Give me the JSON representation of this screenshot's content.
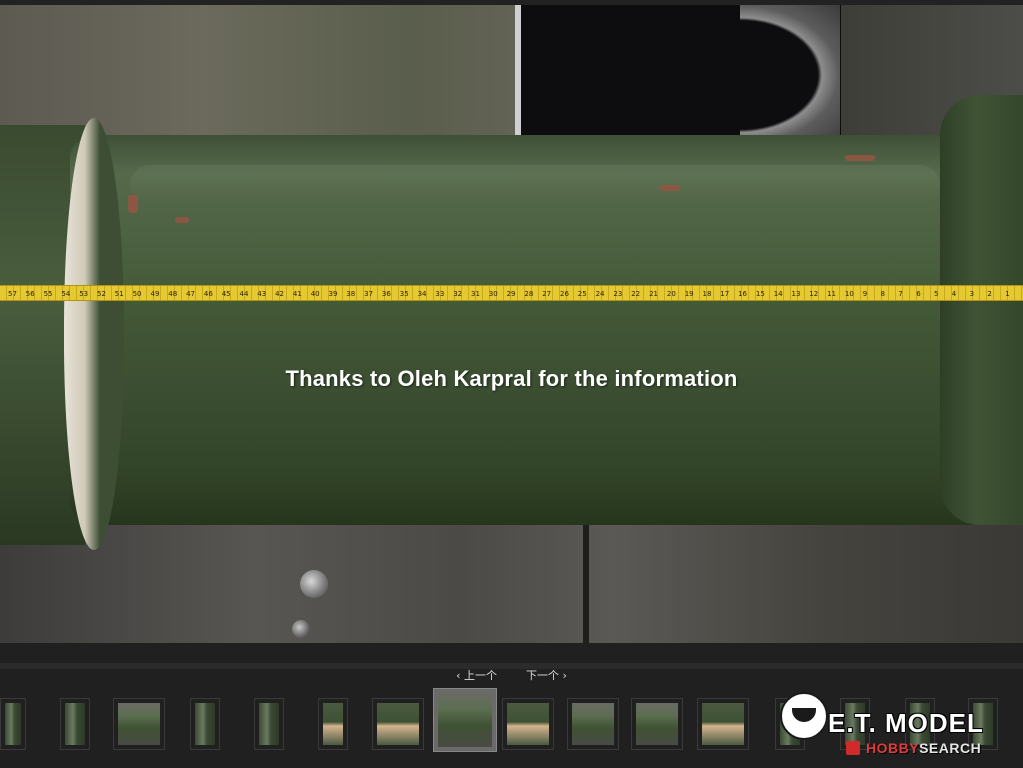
{
  "photo": {
    "caption": "Thanks to Oleh Karpral for the information",
    "tape_numbers": [
      "57",
      "56",
      "55",
      "54",
      "53",
      "52",
      "51",
      "50",
      "49",
      "48",
      "47",
      "46",
      "45",
      "44",
      "43",
      "42",
      "41",
      "40",
      "39",
      "38",
      "37",
      "36",
      "35",
      "34",
      "33",
      "32",
      "31",
      "30",
      "29",
      "28",
      "27",
      "26",
      "25",
      "24",
      "23",
      "22",
      "21",
      "20",
      "19",
      "18",
      "17",
      "16",
      "15",
      "14",
      "13",
      "12",
      "11",
      "10",
      "9",
      "8",
      "7",
      "6",
      "5",
      "4",
      "3",
      "2",
      "1"
    ]
  },
  "pager": {
    "prev_label": "‹ 上一个",
    "next_label": "下一个 ›"
  },
  "thumbnails": [
    {
      "style": "img-v"
    },
    {
      "style": "img-v"
    },
    {
      "style": "img-h"
    },
    {
      "style": "img-v"
    },
    {
      "style": "img-v"
    },
    {
      "style": "img-hand"
    },
    {
      "style": "img-hand"
    },
    {
      "style": "img-h",
      "active": true
    },
    {
      "style": "img-hand"
    },
    {
      "style": "img-h"
    },
    {
      "style": "img-h"
    },
    {
      "style": "img-hand"
    },
    {
      "style": "img-v"
    },
    {
      "style": "img-v"
    },
    {
      "style": "img-v"
    },
    {
      "style": "img-v"
    }
  ],
  "watermark": {
    "brand": "E.T. MODEL",
    "hobby_part1": "HOBBY",
    "hobby_part2": "SEARCH"
  }
}
